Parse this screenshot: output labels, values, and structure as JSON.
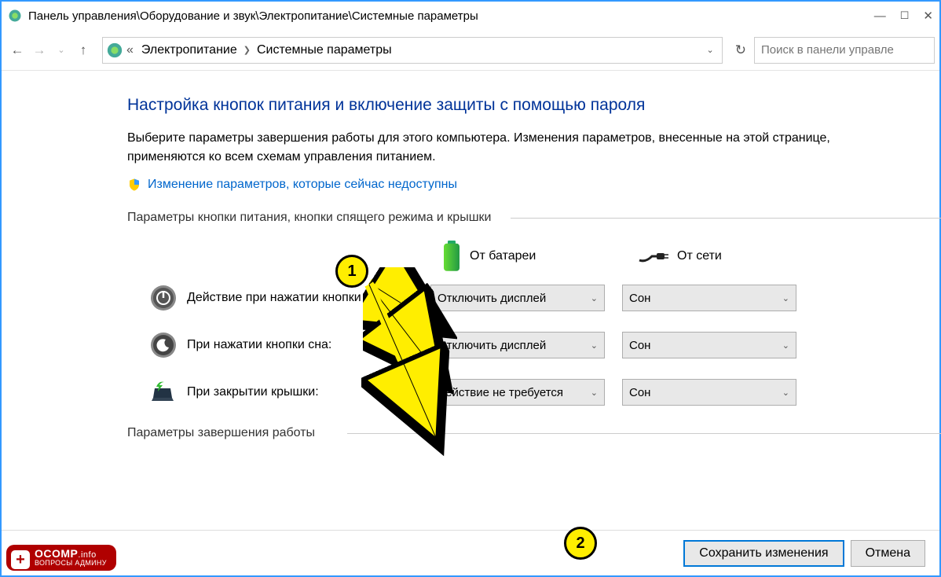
{
  "window": {
    "title": "Панель управления\\Оборудование и звук\\Электропитание\\Системные параметры"
  },
  "breadcrumb": {
    "prefix": "«",
    "item1": "Электропитание",
    "item2": "Системные параметры"
  },
  "search": {
    "placeholder": "Поиск в панели управле"
  },
  "page": {
    "heading": "Настройка кнопок питания и включение защиты с помощью пароля",
    "description": "Выберите параметры завершения работы для этого компьютера. Изменения параметров, внесенные на этой странице, применяются ко всем схемам управления питанием.",
    "uac_link": "Изменение параметров, которые сейчас недоступны",
    "section1_title": "Параметры кнопки питания, кнопки спящего режима и крышки",
    "section2_title": "Параметры завершения работы"
  },
  "columns": {
    "battery": "От батареи",
    "plugged": "От сети"
  },
  "rows": [
    {
      "label": "Действие при нажатии кнопки питания:",
      "battery": "Отключить дисплей",
      "plug": "Сон"
    },
    {
      "label": "При нажатии кнопки сна:",
      "battery": "Отключить дисплей",
      "plug": "Сон"
    },
    {
      "label": "При закрытии крышки:",
      "battery": "Действие не требуется",
      "plug": "Сон"
    }
  ],
  "buttons": {
    "save": "Сохранить изменения",
    "cancel": "Отмена"
  },
  "annotations": {
    "marker1": "1",
    "marker2": "2"
  },
  "badge": {
    "line1a": "OCOMP",
    "line1b": ".info",
    "line2": "ВОПРОСЫ АДМИНУ"
  }
}
